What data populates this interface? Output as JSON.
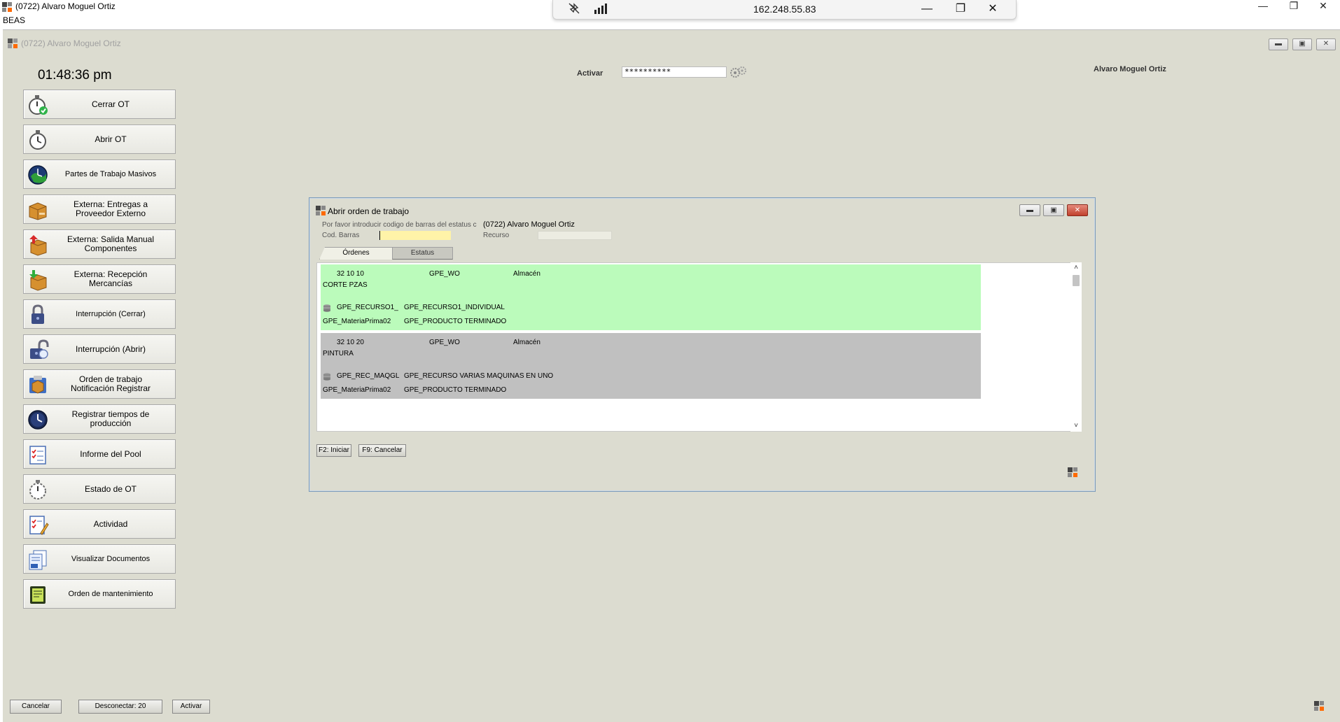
{
  "outer_window": {
    "title": "(0722) Alvaro Moguel Ortiz",
    "subtitle": "BEAS"
  },
  "rdp_bar": {
    "ip": "162.248.55.83"
  },
  "app": {
    "title": "(0722) Alvaro Moguel Ortiz",
    "clock": "01:48:36 pm",
    "activar_label": "Activar",
    "activar_value": "**********",
    "user_name": "Alvaro Moguel Ortiz"
  },
  "sidebar": {
    "items": [
      {
        "label": "Cerrar OT",
        "icon": "stopwatch-check-icon"
      },
      {
        "label": "Abrir OT",
        "icon": "stopwatch-icon"
      },
      {
        "label": "Partes de Trabajo Masivos",
        "icon": "clock-globe-icon"
      },
      {
        "label": "Externa: Entregas a\nProveedor Externo",
        "icon": "box-icon"
      },
      {
        "label": "Externa: Salida Manual\nComponentes",
        "icon": "box-out-icon"
      },
      {
        "label": "Externa: Recepción\nMercancías",
        "icon": "box-in-icon"
      },
      {
        "label": "Interrupción (Cerrar)",
        "icon": "padlock-icon"
      },
      {
        "label": "Interrupción (Abrir)",
        "icon": "padlock-open-icon"
      },
      {
        "label": "Orden de trabajo\nNotificación Registrar",
        "icon": "clipboard-box-icon"
      },
      {
        "label": "Registrar tiempos de\nproducción",
        "icon": "clock-icon"
      },
      {
        "label": "Informe del Pool",
        "icon": "checklist-icon"
      },
      {
        "label": "Estado de OT",
        "icon": "stopwatch-dashed-icon"
      },
      {
        "label": "Actividad",
        "icon": "checklist-pencil-icon"
      },
      {
        "label": "Visualizar Documentos",
        "icon": "documents-icon"
      },
      {
        "label": "Orden de mantenimiento",
        "icon": "notebook-icon"
      }
    ]
  },
  "bottom_buttons": {
    "cancelar": "Cancelar",
    "desconectar": "Desconectar: 20",
    "activar": "Activar"
  },
  "dialog": {
    "title": "Abrir orden de trabajo",
    "prompt": "Por favor introducir codigo de barras del estatus c",
    "prompt_user": "(0722) Alvaro Moguel Ortiz",
    "barcode_label": "Cod. Barras",
    "recurso_label": "Recurso",
    "tabs": {
      "ordenes": "Órdenes",
      "estatus": "Estatus"
    },
    "orders": [
      {
        "number": "32 10 10",
        "wo": "GPE_WO",
        "almacen": "Almacén",
        "operation": "CORTE PZAS",
        "resource": "GPE_RECURSO1_",
        "resource_desc": "GPE_RECURSO1_INDIVIDUAL",
        "material": "GPE_MateriaPrima02",
        "product": "GPE_PRODUCTO TERMINADO",
        "color": "#bbfbbb"
      },
      {
        "number": "32 10 20",
        "wo": "GPE_WO",
        "almacen": "Almacén",
        "operation": "PINTURA",
        "resource": "GPE_REC_MAQGL",
        "resource_desc": "GPE_RECURSO VARIAS MAQUINAS EN UNO",
        "material": "GPE_MateriaPrima02",
        "product": "GPE_PRODUCTO TERMINADO",
        "color": "#c0c0c0"
      }
    ],
    "actions": {
      "iniciar": "F2: Iniciar",
      "cancelar": "F9: Cancelar"
    }
  }
}
